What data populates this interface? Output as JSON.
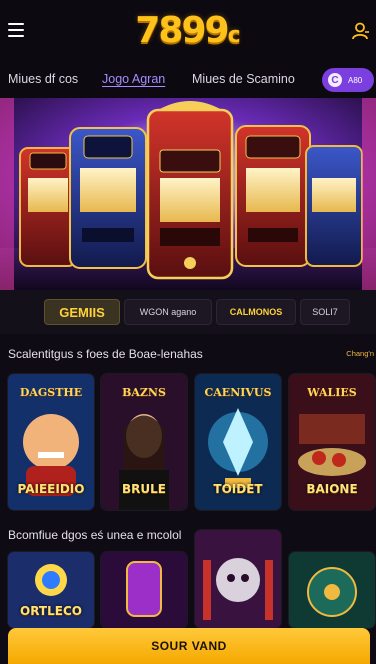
{
  "header": {
    "logo_main": "7899",
    "logo_suffix": "c"
  },
  "nav": {
    "items": [
      {
        "label": "Miues df cos"
      },
      {
        "label": "Jogo Agran"
      },
      {
        "label": "Miues de Scamino"
      }
    ],
    "active_index": 1,
    "pill_icon": "C",
    "pill_text": "A80"
  },
  "categories": [
    {
      "label": "GEMIIS"
    },
    {
      "label": "WGON agano"
    },
    {
      "label": "CALMONOS"
    },
    {
      "label": "SOLI7"
    }
  ],
  "section1": {
    "title": "Scalentitgus s foes de Boae-lenahas",
    "link": "Chang'n"
  },
  "section2": {
    "title": "Bcomfiue dgos eś unea e mcolol"
  },
  "games_row1": [
    {
      "title": "PAIEEIDIO",
      "top": "DAGSTHE"
    },
    {
      "title": "BRULE",
      "top": "BAZNS"
    },
    {
      "title": "TOIDET",
      "top": "CAENIVUS"
    },
    {
      "title": "BAIONE",
      "top": "WALIES"
    }
  ],
  "games_row2": [
    {
      "title": "ORTLECO"
    },
    {
      "title": ""
    },
    {
      "title": ""
    },
    {
      "title": ""
    }
  ],
  "cta": {
    "label": "SOUR VAND"
  },
  "colors": {
    "background": "#0f0b14",
    "accent_gold": "#ffc21a",
    "accent_purple": "#7b3fe0",
    "active_nav": "#a58cff"
  }
}
